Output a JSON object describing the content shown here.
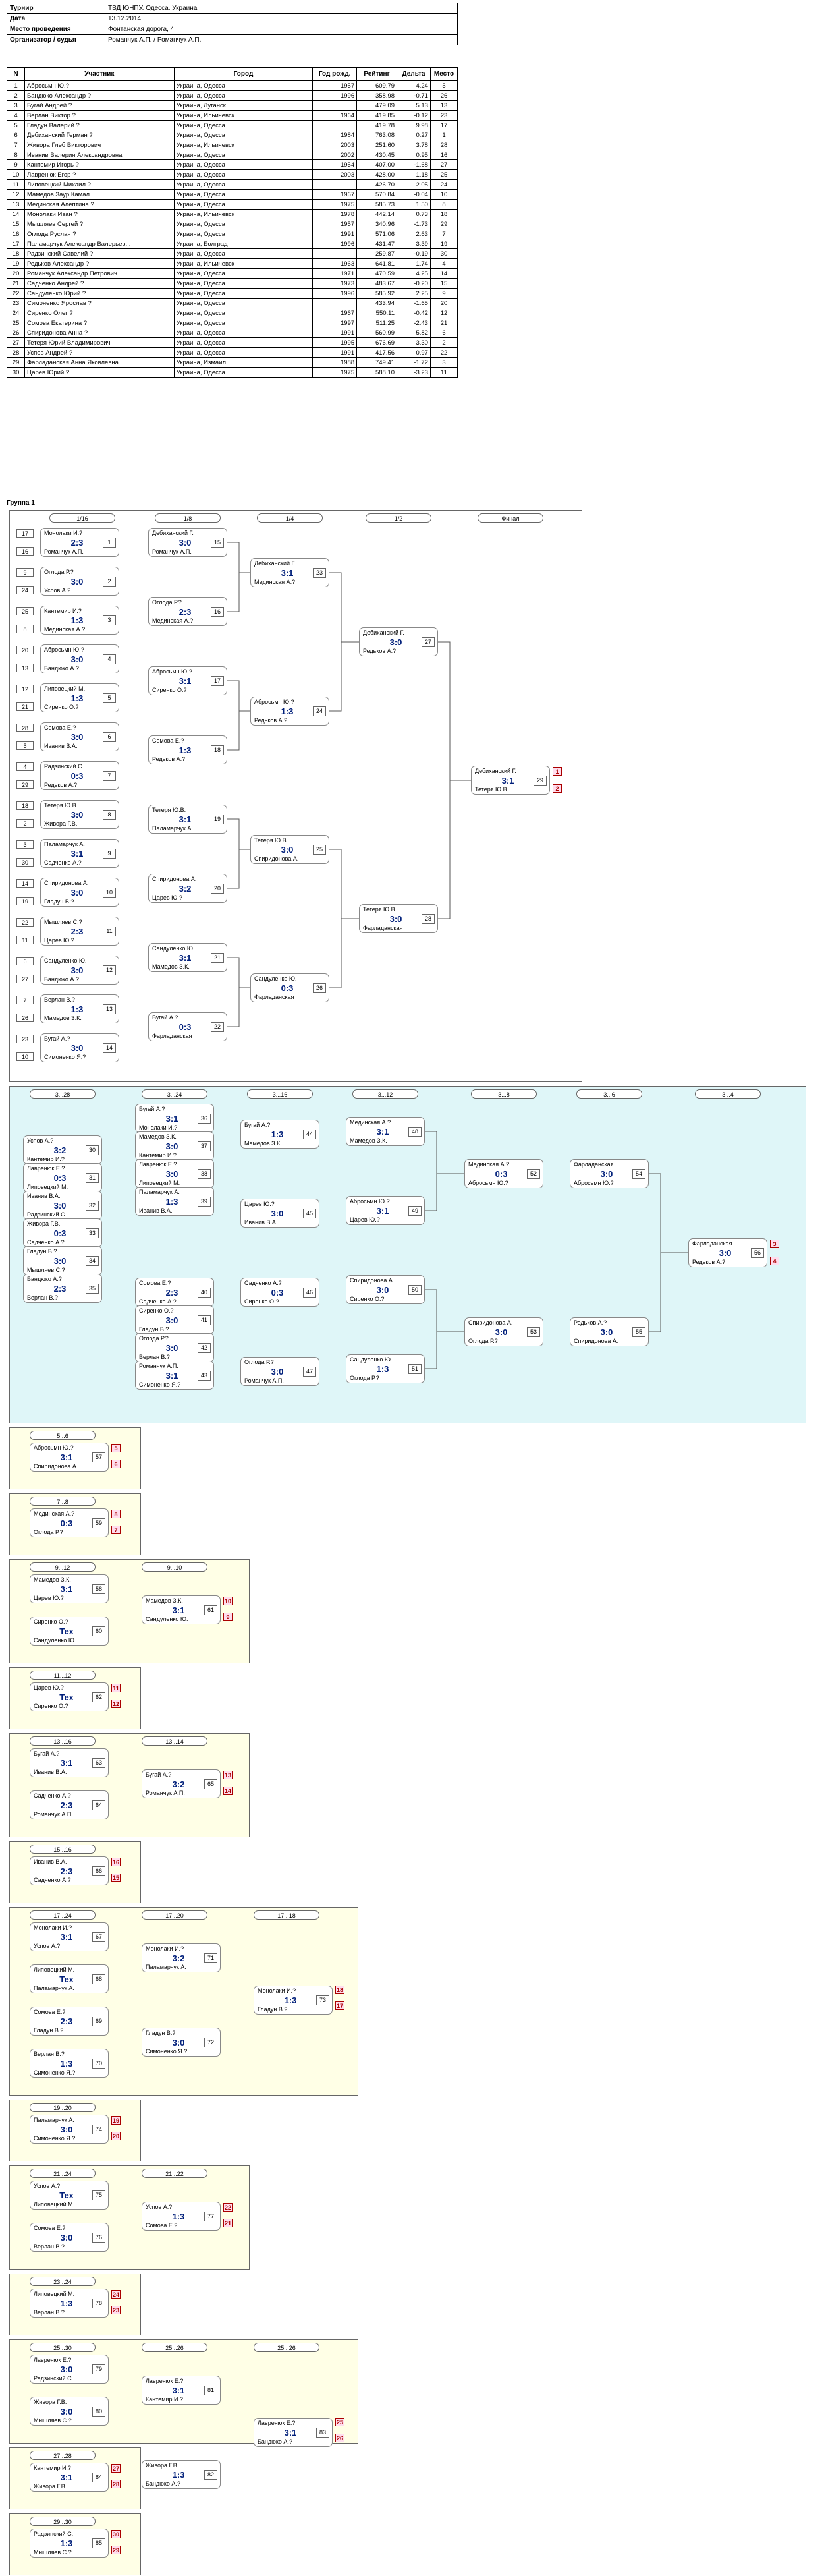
{
  "info": {
    "rows": [
      {
        "k": "Турнир",
        "v": "ТВД ЮНПУ. Одесса. Украина"
      },
      {
        "k": "Дата",
        "v": "13.12.2014"
      },
      {
        "k": "Место проведения",
        "v": "Фонтанская дорога, 4"
      },
      {
        "k": "Организатор / судья",
        "v": "Романчук А.П. / Романчук А.П."
      }
    ]
  },
  "players": {
    "headers": [
      "N",
      "Участник",
      "Город",
      "Год рожд.",
      "Рейтинг",
      "Дельта",
      "Место"
    ],
    "rows": [
      [
        "1",
        "Абросьмн Ю.?",
        "Украина, Одесса",
        "1957",
        "609.79",
        "4.24",
        "5"
      ],
      [
        "2",
        "Бандюко Александр ?",
        "Украина, Одесса",
        "1996",
        "358.98",
        "-0.71",
        "26"
      ],
      [
        "3",
        "Бугай Андрей ?",
        "Украина, Луганск",
        "",
        "479.09",
        "5.13",
        "13"
      ],
      [
        "4",
        "Верлан Виктор ?",
        "Украина, Ильичевск",
        "1964",
        "419.85",
        "-0.12",
        "23"
      ],
      [
        "5",
        "Гладун Валерий ?",
        "Украина, Одесса",
        "",
        "419.78",
        "9.98",
        "17"
      ],
      [
        "6",
        "Дебиханский Герман ?",
        "Украина, Одесса",
        "1984",
        "763.08",
        "0.27",
        "1"
      ],
      [
        "7",
        "Живора Глеб Викторович",
        "Украина, Ильичевск",
        "2003",
        "251.60",
        "3.78",
        "28"
      ],
      [
        "8",
        "Иванив Валерия Александровна",
        "Украина, Одесса",
        "2002",
        "430.45",
        "0.95",
        "16"
      ],
      [
        "9",
        "Кантемир Игорь ?",
        "Украина, Одесса",
        "1954",
        "407.00",
        "-1.68",
        "27"
      ],
      [
        "10",
        "Лавренюк Егор ?",
        "Украина, Одесса",
        "2003",
        "428.00",
        "1.18",
        "25"
      ],
      [
        "11",
        "Липовецкий Михаил ?",
        "Украина, Одесса",
        "",
        "426.70",
        "2.05",
        "24"
      ],
      [
        "12",
        "Мамедов Заур Камал",
        "Украина, Одесса",
        "1967",
        "570.84",
        "-0.04",
        "10"
      ],
      [
        "13",
        "Мединская Алептина ?",
        "Украина, Одесса",
        "1975",
        "585.73",
        "1.50",
        "8"
      ],
      [
        "14",
        "Монолаки Иван ?",
        "Украина, Ильичевск",
        "1978",
        "442.14",
        "0.73",
        "18"
      ],
      [
        "15",
        "Мышляев Сергей ?",
        "Украина, Одесса",
        "1957",
        "340.96",
        "-1.73",
        "29"
      ],
      [
        "16",
        "Оглода Руслан ?",
        "Украина, Одесса",
        "1991",
        "571.06",
        "2.63",
        "7"
      ],
      [
        "17",
        "Паламарчук Александр Валерьев...",
        "Украина, Болград",
        "1996",
        "431.47",
        "3.39",
        "19"
      ],
      [
        "18",
        "Радзинский Савелий ?",
        "Украина, Одесса",
        "",
        "259.87",
        "-0.19",
        "30"
      ],
      [
        "19",
        "Редьков Александр ?",
        "Украина, Ильичевск",
        "1963",
        "641.81",
        "1.74",
        "4"
      ],
      [
        "20",
        "Романчук Александр Петрович",
        "Украина, Одесса",
        "1971",
        "470.59",
        "4.25",
        "14"
      ],
      [
        "21",
        "Садченко Андрей ?",
        "Украина, Одесса",
        "1973",
        "483.67",
        "-0.20",
        "15"
      ],
      [
        "22",
        "Сандуленко Юрий ?",
        "Украина, Одесса",
        "1996",
        "585.92",
        "2.25",
        "9"
      ],
      [
        "23",
        "Симоненко Ярослав ?",
        "Украина, Одесса",
        "",
        "433.94",
        "-1.65",
        "20"
      ],
      [
        "24",
        "Сиренко Олег ?",
        "Украина, Одесса",
        "1967",
        "550.11",
        "-0.42",
        "12"
      ],
      [
        "25",
        "Сомова Екатерина ?",
        "Украина, Одесса",
        "1997",
        "511.25",
        "-2.43",
        "21"
      ],
      [
        "26",
        "Спиридонова Анна ?",
        "Украина, Одесса",
        "1991",
        "560.99",
        "5.82",
        "6"
      ],
      [
        "27",
        "Тетеря Юрий Владимирович",
        "Украина, Одесса",
        "1995",
        "676.69",
        "3.30",
        "2"
      ],
      [
        "28",
        "Успов Андрей ?",
        "Украина, Одесса",
        "1991",
        "417.56",
        "0.97",
        "22"
      ],
      [
        "29",
        "Фарладанская Анна Яковлевна",
        "Украина, Измаил",
        "1988",
        "749.41",
        "-1.72",
        "3"
      ],
      [
        "30",
        "Царев Юрий ?",
        "Украина, Одесса",
        "1975",
        "588.10",
        "-3.23",
        "11"
      ]
    ]
  },
  "group_title": "Группа 1",
  "main": {
    "headers": [
      "1/16",
      "1/8",
      "1/4",
      "1/2",
      "Финал"
    ],
    "seeds": [
      "17",
      "16",
      "9",
      "24",
      "25",
      "8",
      "20",
      "13",
      "12",
      "21",
      "28",
      "5",
      "4",
      "29",
      "18",
      "2",
      "3",
      "30",
      "14",
      "19",
      "22",
      "11",
      "6",
      "27",
      "7",
      "26",
      "23",
      "10",
      "15"
    ],
    "matches": [
      {
        "p1": "Монолаки И.?",
        "p2": "Романчук А.П.",
        "sc": "2:3",
        "n": "1"
      },
      {
        "p1": "Оглода Р.?",
        "p2": "Успов А.?",
        "sc": "3:0",
        "n": "2"
      },
      {
        "p1": "Кантемир И.?",
        "p2": "Мединская А.?",
        "sc": "1:3",
        "n": "3"
      },
      {
        "p1": "Абросьмн Ю.?",
        "p2": "Бандюко А.?",
        "sc": "3:0",
        "n": "4"
      },
      {
        "p1": "Липовецкий М.",
        "p2": "Сиренко О.?",
        "sc": "1:3",
        "n": "5"
      },
      {
        "p1": "Сомова Е.?",
        "p2": "Иванив В.А.",
        "sc": "3:0",
        "n": "6"
      },
      {
        "p1": "Радзинский С.",
        "p2": "Редьков А.?",
        "sc": "0:3",
        "n": "7"
      },
      {
        "p1": "Тетеря Ю.В.",
        "p2": "Живора Г.В.",
        "sc": "3:0",
        "n": "8"
      },
      {
        "p1": "Паламарчук А.",
        "p2": "Садченко А.?",
        "sc": "3:1",
        "n": "9"
      },
      {
        "p1": "Спиридонова А.",
        "p2": "Гладун В.?",
        "sc": "3:0",
        "n": "10"
      },
      {
        "p1": "Мышляев С.?",
        "p2": "Царев Ю.?",
        "sc": "2:3",
        "n": "11"
      },
      {
        "p1": "Сандуленко Ю.",
        "p2": "Бандюко А.?",
        "sc": "3:0",
        "n": "12"
      },
      {
        "p1": "Верлан В.?",
        "p2": "Мамедов З.К.",
        "sc": "1:3",
        "n": "13"
      },
      {
        "p1": "Бугай А.?",
        "p2": "Симоненко Я.?",
        "sc": "3:0",
        "n": "14"
      },
      {
        "p1": "Дебиханский Г.",
        "p2": "Романчук А.П.",
        "sc": "3:0",
        "n": "15"
      },
      {
        "p1": "Оглода Р.?",
        "p2": "Мединская А.?",
        "sc": "2:3",
        "n": "16"
      },
      {
        "p1": "Абросьмн Ю.?",
        "p2": "Сиренко О.?",
        "sc": "3:1",
        "n": "17"
      },
      {
        "p1": "Сомова Е.?",
        "p2": "Редьков А.?",
        "sc": "1:3",
        "n": "18"
      },
      {
        "p1": "Тетеря Ю.В.",
        "p2": "Паламарчук А.",
        "sc": "3:1",
        "n": "19"
      },
      {
        "p1": "Спиридонова А.",
        "p2": "Царев Ю.?",
        "sc": "3:2",
        "n": "20"
      },
      {
        "p1": "Сандуленко Ю.",
        "p2": "Мамедов З.К.",
        "sc": "3:1",
        "n": "21"
      },
      {
        "p1": "Бугай А.?",
        "p2": "Фарладанская",
        "sc": "0:3",
        "n": "22"
      },
      {
        "p1": "Дебиханский Г.",
        "p2": "Мединская А.?",
        "sc": "3:1",
        "n": "23"
      },
      {
        "p1": "Абросьмн Ю.?",
        "p2": "Редьков А.?",
        "sc": "1:3",
        "n": "24"
      },
      {
        "p1": "Тетеря Ю.В.",
        "p2": "Спиридонова А.",
        "sc": "3:0",
        "n": "25"
      },
      {
        "p1": "Сандуленко Ю.",
        "p2": "Фарладанская",
        "sc": "0:3",
        "n": "26"
      },
      {
        "p1": "Дебиханский Г.",
        "p2": "Редьков А.?",
        "sc": "3:0",
        "n": "27"
      },
      {
        "p1": "Тетеря Ю.В.",
        "p2": "Фарладанская",
        "sc": "3:0",
        "n": "28"
      },
      {
        "p1": "Дебиханский Г.",
        "p2": "Тетеря Ю.В.",
        "sc": "3:1",
        "n": "29"
      }
    ],
    "final_places": [
      "1",
      "2"
    ]
  },
  "consolation": {
    "headers": [
      "3...28",
      "3...24",
      "3...16",
      "3...12",
      "3...8",
      "3...6",
      "3...4"
    ],
    "matches": [
      {
        "p1": "Бугай А.?",
        "p2": "Монолаки И.?",
        "sc": "3:1",
        "n": "36"
      },
      {
        "p1": "Мамедов З.К.",
        "p2": "Кантемир И.?",
        "sc": "3:0",
        "n": "37"
      },
      {
        "p1": "Лавренюк Е.?",
        "p2": "Липовецкий М.",
        "sc": "3:0",
        "n": "38"
      },
      {
        "p1": "Паламарчук А.",
        "p2": "Иванив В.А.",
        "sc": "1:3",
        "n": "39"
      },
      {
        "p1": "Успов А.?",
        "p2": "Кантемир И.?",
        "sc": "3:2",
        "n": "30"
      },
      {
        "p1": "Лавренюк Е.?",
        "p2": "Липовецкий М.",
        "sc": "0:3",
        "n": "31"
      },
      {
        "p1": "Иванив В.А.",
        "p2": "Радзинский С.",
        "sc": "3:0",
        "n": "32"
      },
      {
        "p1": "Живора Г.В.",
        "p2": "Садченко А.?",
        "sc": "0:3",
        "n": "33"
      },
      {
        "p1": "Гладун В.?",
        "p2": "Мышляев С.?",
        "sc": "3:0",
        "n": "34"
      },
      {
        "p1": "Бандюко А.?",
        "p2": "Верлан В.?",
        "sc": "2:3",
        "n": "35"
      },
      {
        "p1": "Сомова Е.?",
        "p2": "Садченко А.?",
        "sc": "2:3",
        "n": "40"
      },
      {
        "p1": "Сиренко О.?",
        "p2": "Гладун В.?",
        "sc": "3:0",
        "n": "41"
      },
      {
        "p1": "Оглода Р.?",
        "p2": "Верлан В.?",
        "sc": "3:0",
        "n": "42"
      },
      {
        "p1": "Романчук А.П.",
        "p2": "Симоненко Я.?",
        "sc": "3:1",
        "n": "43"
      },
      {
        "p1": "Бугай А.?",
        "p2": "Мамедов З.К.",
        "sc": "1:3",
        "n": "44"
      },
      {
        "p1": "Царев Ю.?",
        "p2": "Иванив В.А.",
        "sc": "3:0",
        "n": "45"
      },
      {
        "p1": "Садченко А.?",
        "p2": "Сиренко О.?",
        "sc": "0:3",
        "n": "46"
      },
      {
        "p1": "Оглода Р.?",
        "p2": "Романчук А.П.",
        "sc": "3:0",
        "n": "47"
      },
      {
        "p1": "Мединская А.?",
        "p2": "Мамедов З.К.",
        "sc": "3:1",
        "n": "48"
      },
      {
        "p1": "Абросьмн Ю.?",
        "p2": "Царев Ю.?",
        "sc": "3:1",
        "n": "49"
      },
      {
        "p1": "Спиридонова А.",
        "p2": "Сиренко О.?",
        "sc": "3:0",
        "n": "50"
      },
      {
        "p1": "Сандуленко Ю.",
        "p2": "Оглода Р.?",
        "sc": "1:3",
        "n": "51"
      },
      {
        "p1": "Мединская А.?",
        "p2": "Абросьмн Ю.?",
        "sc": "0:3",
        "n": "52"
      },
      {
        "p1": "Спиридонова А.",
        "p2": "Оглода Р.?",
        "sc": "3:0",
        "n": "53"
      },
      {
        "p1": "Фарладанская",
        "p2": "Абросьмн Ю.?",
        "sc": "3:0",
        "n": "54"
      },
      {
        "p1": "Редьков А.?",
        "p2": "Спиридонова А.",
        "sc": "3:0",
        "n": "55"
      },
      {
        "p1": "Фарладанская",
        "p2": "Редьков А.?",
        "sc": "3:0",
        "n": "56"
      }
    ],
    "final_places": [
      "3",
      "4"
    ]
  },
  "sections": [
    {
      "title": "5...6",
      "matches": [
        {
          "p1": "Абросьмн Ю.?",
          "p2": "Спиридонова А.",
          "sc": "3:1",
          "n": "57"
        }
      ],
      "places": [
        "5",
        "6"
      ]
    },
    {
      "title": "7...8",
      "matches": [
        {
          "p1": "Мединская А.?",
          "p2": "Оглода Р.?",
          "sc": "0:3",
          "n": "59"
        }
      ],
      "places": [
        "8",
        "7"
      ]
    },
    {
      "title": "9...12",
      "matches": [
        {
          "p1": "Мамедов З.К.",
          "p2": "Царев Ю.?",
          "sc": "3:1",
          "n": "58"
        },
        {
          "p1": "Сиренко О.?",
          "p2": "Сандуленко Ю.",
          "sc": "Тех",
          "n": "60"
        }
      ],
      "title2": "9...10",
      "final": {
        "p1": "Мамедов З.К.",
        "p2": "Сандуленко Ю.",
        "sc": "3:1",
        "n": "61"
      },
      "places": [
        "10",
        "9"
      ]
    },
    {
      "title": "11...12",
      "matches": [
        {
          "p1": "Царев Ю.?",
          "p2": "Сиренко О.?",
          "sc": "Тех",
          "n": "62"
        }
      ],
      "places": [
        "11",
        "12"
      ]
    },
    {
      "title": "13...16",
      "matches": [
        {
          "p1": "Бугай А.?",
          "p2": "Иванив В.А.",
          "sc": "3:1",
          "n": "63"
        },
        {
          "p1": "Садченко А.?",
          "p2": "Романчук А.П.",
          "sc": "2:3",
          "n": "64"
        }
      ],
      "title2": "13...14",
      "final": {
        "p1": "Бугай А.?",
        "p2": "Романчук А.П.",
        "sc": "3:2",
        "n": "65"
      },
      "places": [
        "13",
        "14"
      ]
    },
    {
      "title": "15...16",
      "matches": [
        {
          "p1": "Иванив В.А.",
          "p2": "Садченко А.?",
          "sc": "2:3",
          "n": "66"
        }
      ],
      "places": [
        "16",
        "15"
      ]
    },
    {
      "title": "17...24",
      "matches": [
        {
          "p1": "Монолаки И.?",
          "p2": "Успов А.?",
          "sc": "3:1",
          "n": "67"
        },
        {
          "p1": "Липовецкий М.",
          "p2": "Паламарчук А.",
          "sc": "Тех",
          "n": "68"
        },
        {
          "p1": "Сомова Е.?",
          "p2": "Гладун В.?",
          "sc": "2:3",
          "n": "69"
        },
        {
          "p1": "Верлан В.?",
          "p2": "Симоненко Я.?",
          "sc": "1:3",
          "n": "70"
        }
      ],
      "title2": "17...20",
      "final": {
        "p1": "Монолаки И.?",
        "p2": "Паламарчук А.",
        "sc": "3:2",
        "n": "71"
      },
      "final2": {
        "p1": "Гладун В.?",
        "p2": "Симоненко Я.?",
        "sc": "3:0",
        "n": "72"
      },
      "title3": "17...18",
      "final3": {
        "p1": "Монолаки И.?",
        "p2": "Гладун В.?",
        "sc": "1:3",
        "n": "73"
      },
      "places": [
        "18",
        "17"
      ]
    },
    {
      "title": "19...20",
      "matches": [
        {
          "p1": "Паламарчук А.",
          "p2": "Симоненко Я.?",
          "sc": "3:0",
          "n": "74"
        }
      ],
      "places": [
        "19",
        "20"
      ]
    },
    {
      "title": "21...24",
      "matches": [
        {
          "p1": "Успов А.?",
          "p2": "Липовецкий М.",
          "sc": "Тех",
          "n": "75"
        },
        {
          "p1": "Сомова Е.?",
          "p2": "Верлан В.?",
          "sc": "3:0",
          "n": "76"
        }
      ],
      "title2": "21...22",
      "final": {
        "p1": "Успов А.?",
        "p2": "Сомова Е.?",
        "sc": "1:3",
        "n": "77"
      },
      "places": [
        "22",
        "21"
      ]
    },
    {
      "title": "23...24",
      "matches": [
        {
          "p1": "Липовецкий М.",
          "p2": "Верлан В.?",
          "sc": "1:3",
          "n": "78"
        }
      ],
      "places": [
        "24",
        "23"
      ]
    },
    {
      "title": "25...30",
      "matches": [
        {
          "p1": "Лавренюк Е.?",
          "p2": "Радзинский С.",
          "sc": "3:0",
          "n": "79"
        },
        {
          "p1": "Живора Г.В.",
          "p2": "Мышляев С.?",
          "sc": "3:0",
          "n": "80"
        }
      ],
      "title2": "25...26",
      "final": {
        "p1": "Лавренюк Е.?",
        "p2": "Кантемир И.?",
        "sc": "3:1",
        "n": "81"
      },
      "final2": {
        "p1": "Живора Г.В.",
        "p2": "Бандюко А.?",
        "sc": "1:3",
        "n": "82"
      },
      "title3": "25...26",
      "final3": {
        "p1": "Лавренюк Е.?",
        "p2": "Бандюко А.?",
        "sc": "3:1",
        "n": "83"
      },
      "places": [
        "25",
        "26"
      ]
    },
    {
      "title": "27...28",
      "matches": [
        {
          "p1": "Кантемир И.?",
          "p2": "Живора Г.В.",
          "sc": "3:1",
          "n": "84"
        }
      ],
      "places": [
        "27",
        "28"
      ]
    },
    {
      "title": "29...30",
      "matches": [
        {
          "p1": "Радзинский С.",
          "p2": "Мышляев С.?",
          "sc": "1:3",
          "n": "85"
        }
      ],
      "places": [
        "30",
        "29"
      ]
    }
  ]
}
